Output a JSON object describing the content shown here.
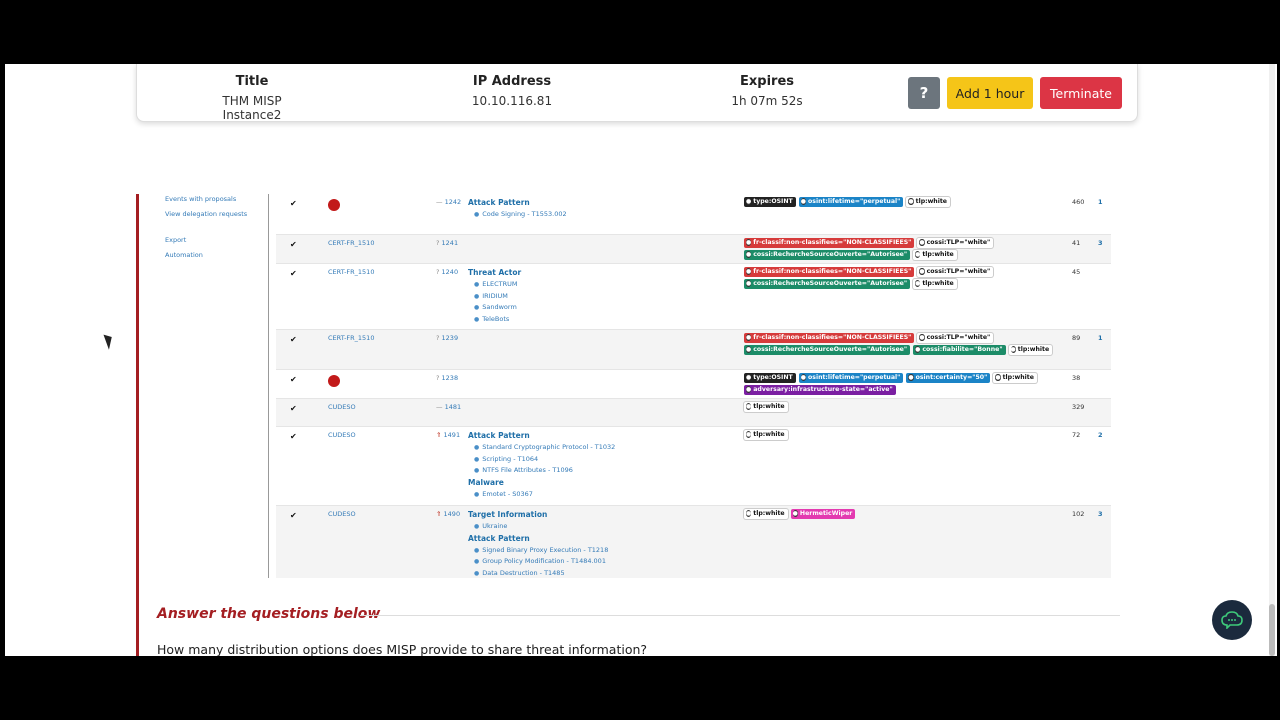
{
  "instance": {
    "title_label": "Title",
    "title_value": "THM MISP Instance2",
    "ip_label": "IP Address",
    "ip_value": "10.10.116.81",
    "expires_label": "Expires",
    "expires_value": "1h 07m 52s",
    "help_label": "?",
    "add_label": "Add 1 hour",
    "terminate_label": "Terminate"
  },
  "sidebar": {
    "items": [
      "Events with proposals",
      "View delegation requests",
      "Export",
      "Automation"
    ]
  },
  "events": [
    {
      "org": "",
      "logo": true,
      "level": "—",
      "id": "1242",
      "info": [
        {
          "cat": "Attack Pattern",
          "items": [
            "Code Signing - T1553.002"
          ]
        }
      ],
      "tags": [
        [
          {
            "t": "type:OSINT",
            "c": "dark"
          },
          {
            "t": "osint:lifetime=\"perpetual\"",
            "c": "blue"
          },
          {
            "t": "tlp:white",
            "c": "white"
          }
        ]
      ],
      "attr": "460",
      "corr": "1"
    },
    {
      "org": "CERT-FR_1510",
      "logo": false,
      "level": "?",
      "id": "1241",
      "info": [],
      "tags": [
        [
          {
            "t": "fr-classif:non-classifiees=\"NON-CLASSIFIEES\"",
            "c": "red"
          },
          {
            "t": "cossi:TLP=\"white\"",
            "c": "white"
          }
        ],
        [
          {
            "t": "cossi:RechercheSourceOuverte=\"Autorisee\"",
            "c": "green"
          },
          {
            "t": "tlp:white",
            "c": "white"
          }
        ]
      ],
      "attr": "41",
      "corr": "3"
    },
    {
      "org": "CERT-FR_1510",
      "logo": false,
      "level": "?",
      "id": "1240",
      "info": [
        {
          "cat": "Threat Actor",
          "items": [
            "ELECTRUM",
            "IRIDIUM",
            "Sandworm",
            "TeleBots"
          ]
        }
      ],
      "tags": [
        [
          {
            "t": "fr-classif:non-classifiees=\"NON-CLASSIFIEES\"",
            "c": "red"
          },
          {
            "t": "cossi:TLP=\"white\"",
            "c": "white"
          }
        ],
        [
          {
            "t": "cossi:RechercheSourceOuverte=\"Autorisee\"",
            "c": "green"
          },
          {
            "t": "tlp:white",
            "c": "white"
          }
        ]
      ],
      "attr": "45",
      "corr": ""
    },
    {
      "org": "CERT-FR_1510",
      "logo": false,
      "level": "?",
      "id": "1239",
      "info": [],
      "tags": [
        [
          {
            "t": "fr-classif:non-classifiees=\"NON-CLASSIFIEES\"",
            "c": "red"
          },
          {
            "t": "cossi:TLP=\"white\"",
            "c": "white"
          }
        ],
        [
          {
            "t": "cossi:RechercheSourceOuverte=\"Autorisee\"",
            "c": "green"
          },
          {
            "t": "cossi:fiabilite=\"Bonne\"",
            "c": "green"
          },
          {
            "t": "tlp:white",
            "c": "white"
          }
        ]
      ],
      "attr": "89",
      "corr": "1"
    },
    {
      "org": "",
      "logo": true,
      "level": "?",
      "id": "1238",
      "info": [],
      "tags": [
        [
          {
            "t": "type:OSINT",
            "c": "dark"
          },
          {
            "t": "osint:lifetime=\"perpetual\"",
            "c": "blue"
          },
          {
            "t": "osint:certainty=\"50\"",
            "c": "blue"
          },
          {
            "t": "tlp:white",
            "c": "white"
          }
        ],
        [
          {
            "t": "adversary:infrastructure-state=\"active\"",
            "c": "purple"
          }
        ]
      ],
      "attr": "38",
      "corr": ""
    },
    {
      "org": "CUDESO",
      "logo": false,
      "level": "—",
      "id": "1481",
      "info": [],
      "tags": [
        [
          {
            "t": "tlp:white",
            "c": "white"
          }
        ]
      ],
      "attr": "329",
      "corr": ""
    },
    {
      "org": "CUDESO",
      "logo": false,
      "level": "⇑",
      "id": "1491",
      "info": [
        {
          "cat": "Attack Pattern",
          "items": [
            "Standard Cryptographic Protocol - T1032",
            "Scripting - T1064",
            "NTFS File Attributes - T1096"
          ]
        },
        {
          "cat": "Malware",
          "items": [
            "Emotet - S0367"
          ]
        }
      ],
      "tags": [
        [
          {
            "t": "tlp:white",
            "c": "white"
          }
        ]
      ],
      "attr": "72",
      "corr": "2"
    },
    {
      "org": "CUDESO",
      "logo": false,
      "level": "⇑",
      "id": "1490",
      "info": [
        {
          "cat": "Target Information",
          "items": [
            "Ukraine"
          ]
        },
        {
          "cat": "Attack Pattern",
          "items": [
            "Signed Binary Proxy Execution - T1218",
            "Group Policy Modification - T1484.001",
            "Data Destruction - T1485"
          ]
        }
      ],
      "tags": [
        [
          {
            "t": "tlp:white",
            "c": "white"
          },
          {
            "t": "HermeticWiper",
            "c": "pink"
          }
        ]
      ],
      "attr": "102",
      "corr": "3"
    }
  ],
  "answer": {
    "heading": "Answer the questions below",
    "question": "How many distribution options does MISP provide to share threat information?"
  }
}
